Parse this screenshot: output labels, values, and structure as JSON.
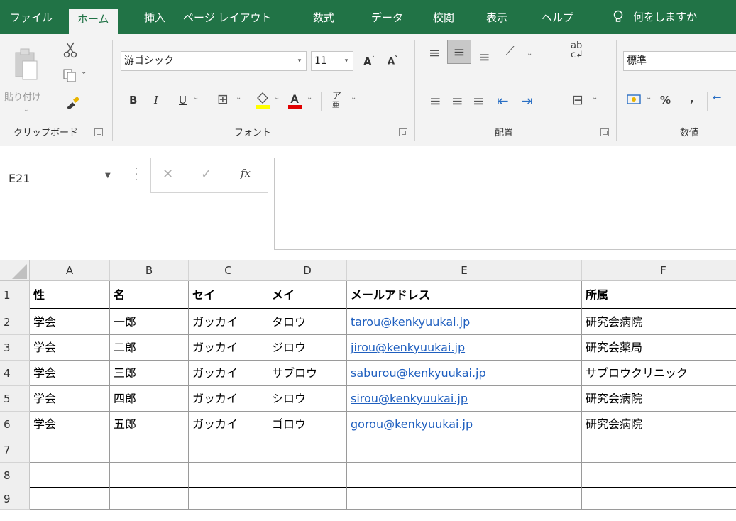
{
  "ribbon_tabs": [
    "ファイル",
    "ホーム",
    "挿入",
    "ページ レイアウト",
    "数式",
    "データ",
    "校閲",
    "表示",
    "ヘルプ",
    "何をしますか"
  ],
  "active_tab": "ホーム",
  "clipboard": {
    "paste_label": "貼り付け",
    "group_label": "クリップボード"
  },
  "font": {
    "name": "游ゴシック",
    "size": "11",
    "group_label": "フォント",
    "bold": "B",
    "italic": "I",
    "underline": "U"
  },
  "alignment": {
    "group_label": "配置"
  },
  "number": {
    "format": "標準",
    "group_label": "数値",
    "percent": "%",
    "comma": ","
  },
  "formula_bar": {
    "name_box": "E21",
    "fx": "fx",
    "content": ""
  },
  "columns": [
    "A",
    "B",
    "C",
    "D",
    "E",
    "F"
  ],
  "rows": [
    {
      "num": "1",
      "cells": [
        "性",
        "名",
        "セイ",
        "メイ",
        "メールアドレス",
        "所属"
      ]
    },
    {
      "num": "2",
      "cells": [
        "学会",
        "一郎",
        "ガッカイ",
        "タロウ",
        "tarou@kenkyuukai.jp",
        "研究会病院"
      ]
    },
    {
      "num": "3",
      "cells": [
        "学会",
        "二郎",
        "ガッカイ",
        "ジロウ",
        "jirou@kenkyuukai.jp",
        "研究会薬局"
      ]
    },
    {
      "num": "4",
      "cells": [
        "学会",
        "三郎",
        "ガッカイ",
        "サブロウ",
        "saburou@kenkyuukai.jp",
        "サブロウクリニック"
      ]
    },
    {
      "num": "5",
      "cells": [
        "学会",
        "四郎",
        "ガッカイ",
        "シロウ",
        "sirou@kenkyuukai.jp",
        "研究会病院"
      ]
    },
    {
      "num": "6",
      "cells": [
        "学会",
        "五郎",
        "ガッカイ",
        "ゴロウ",
        "gorou@kenkyuukai.jp",
        "研究会病院"
      ]
    },
    {
      "num": "7",
      "cells": [
        "",
        "",
        "",
        "",
        "",
        ""
      ]
    },
    {
      "num": "8",
      "cells": [
        "",
        "",
        "",
        "",
        "",
        ""
      ]
    },
    {
      "num": "9",
      "cells": [
        "",
        "",
        "",
        "",
        "",
        ""
      ]
    }
  ],
  "colors": {
    "excel_green": "#217346",
    "link_blue": "#1f5fbf"
  }
}
